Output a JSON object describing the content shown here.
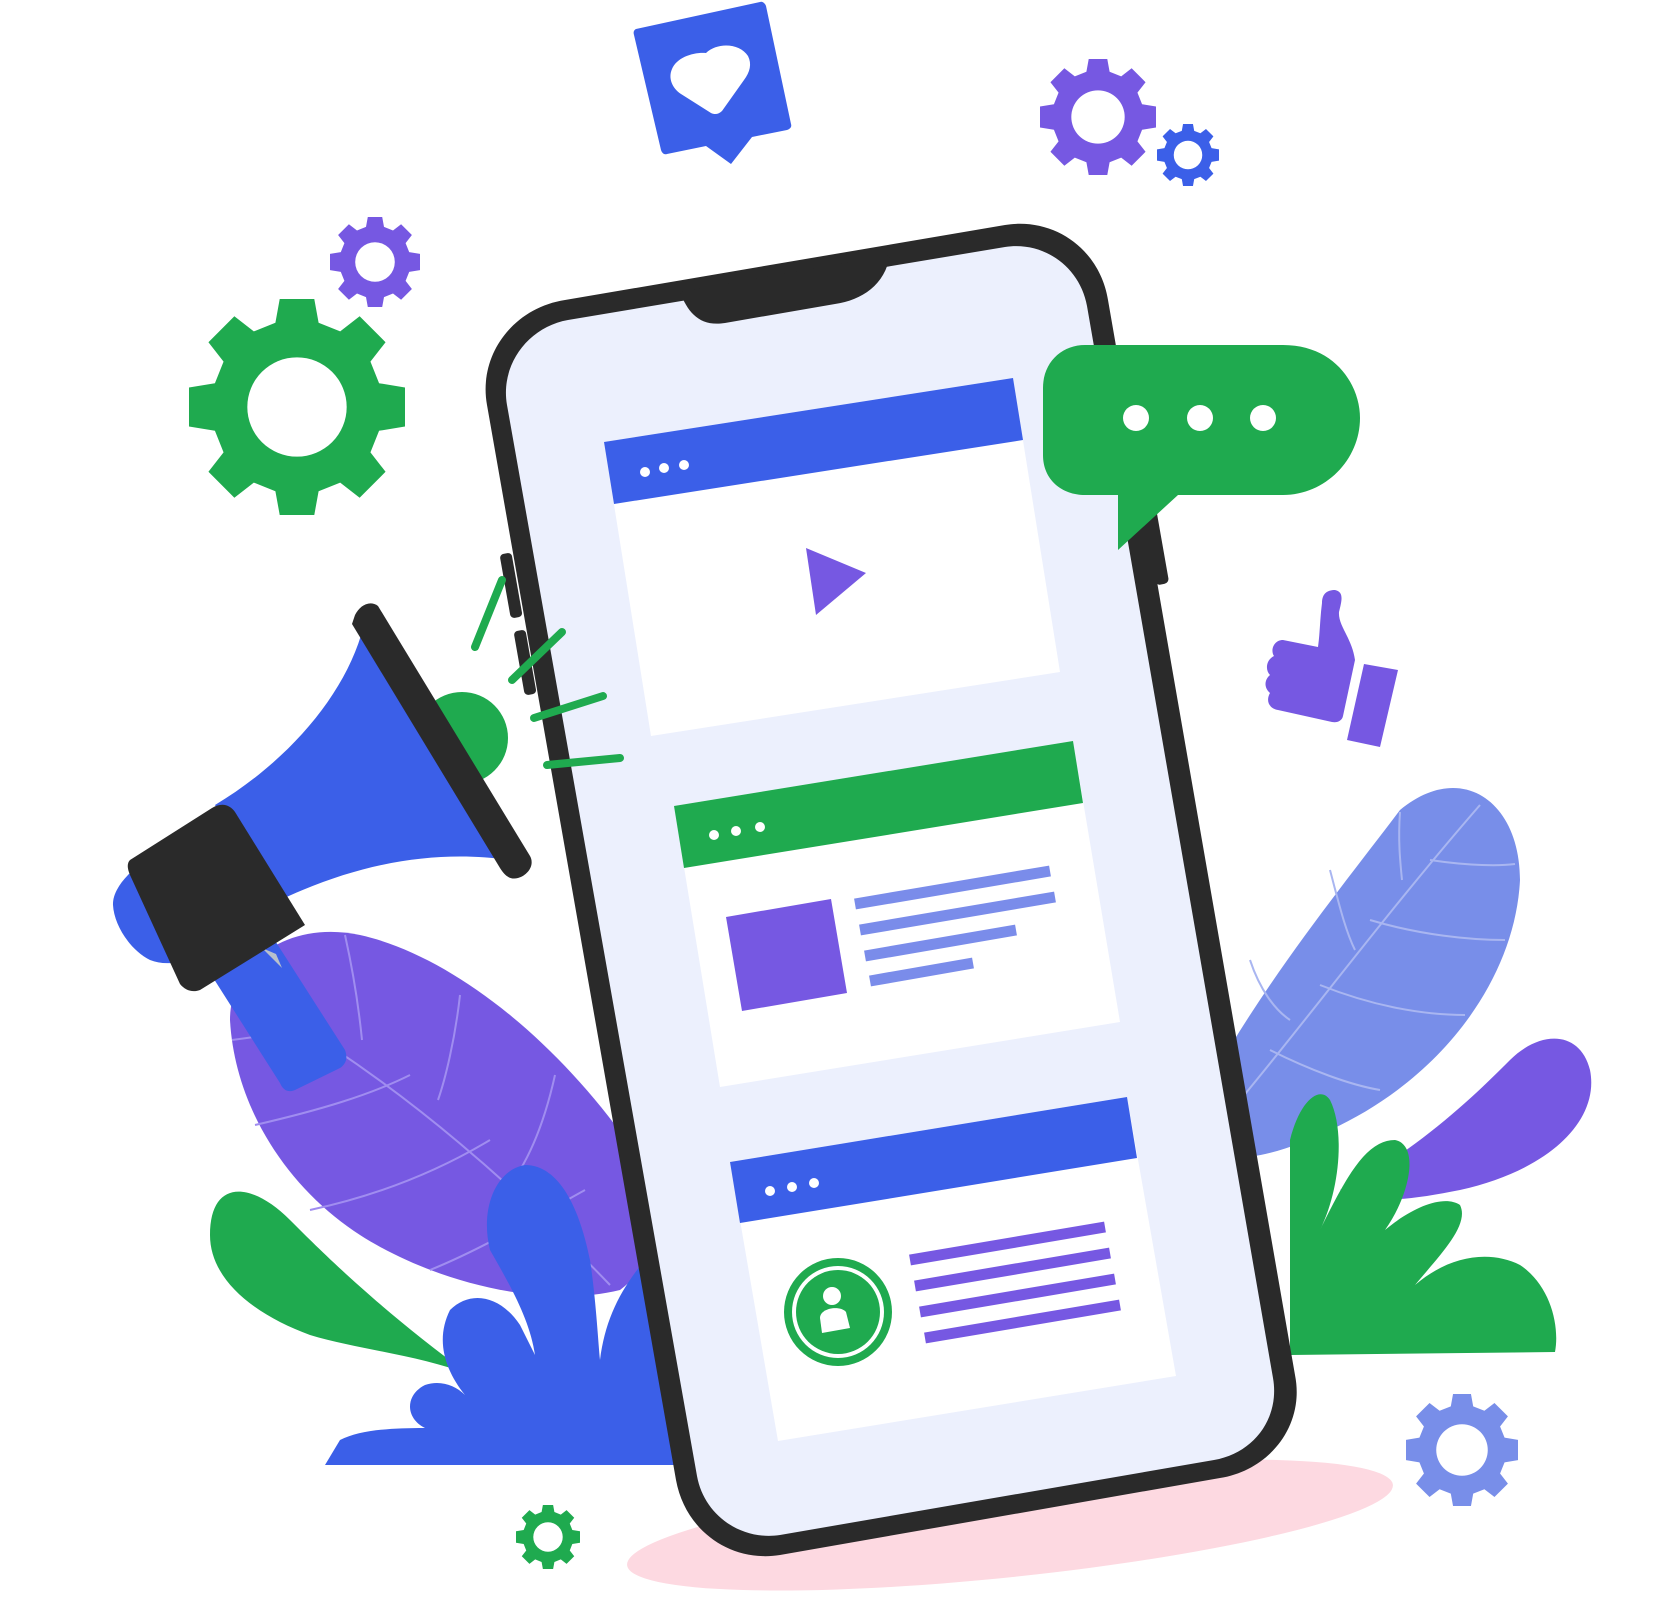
{
  "palette": {
    "background": "#ffffff",
    "blue": "#3b5fe8",
    "purple": "#7658e2",
    "green": "#1faa4f",
    "light_blue": "#788ee9",
    "phone_outline": "#2a2a2a",
    "screen": "#ecf0fd",
    "card": "#ffffff",
    "shadow": "#fdd9e1",
    "text_line_blue": "#7a8cea"
  },
  "scene": {
    "phone": {
      "cards": [
        {
          "header_color": "blue",
          "content": "play-icon",
          "header_dots": 3
        },
        {
          "header_color": "green",
          "content": "image-and-text-lines",
          "header_dots": 3,
          "text_lines": 4
        },
        {
          "header_color": "blue",
          "content": "avatar-and-text-lines",
          "header_dots": 3,
          "text_lines": 4
        }
      ]
    },
    "chat_bubble": {
      "color": "green",
      "dots": 3
    },
    "like_badge": {
      "color": "blue",
      "icon": "heart-icon"
    },
    "thumbs_up": {
      "color": "purple",
      "icon": "thumbs-up-icon"
    },
    "megaphone": {
      "color": "blue",
      "sound_lines": 4
    },
    "gears": [
      {
        "color": "purple",
        "icon": "gear-icon"
      },
      {
        "color": "blue",
        "icon": "gear-icon"
      },
      {
        "color": "purple",
        "icon": "gear-icon"
      },
      {
        "color": "green",
        "icon": "gear-icon"
      },
      {
        "color": "light_blue",
        "icon": "gear-icon"
      },
      {
        "color": "green",
        "icon": "gear-icon"
      }
    ],
    "plants": [
      "purple-leaf",
      "light-blue-leaf",
      "green-leaf",
      "blue-leaf",
      "purple-leaf"
    ]
  }
}
